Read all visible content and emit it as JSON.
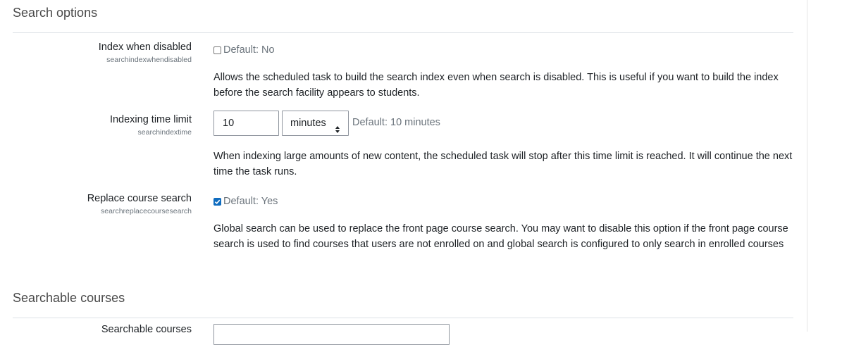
{
  "sections": {
    "search_options": "Search options",
    "searchable_courses": "Searchable courses"
  },
  "settings": {
    "index_disabled": {
      "label": "Index when disabled",
      "key": "searchindexwhendisabled",
      "checked": false,
      "default_text": "Default: No",
      "description": "Allows the scheduled task to build the search index even when search is disabled. This is useful if you want to build the index before the search facility appears to students."
    },
    "time_limit": {
      "label": "Indexing time limit",
      "key": "searchindextime",
      "value": "10",
      "unit": "minutes",
      "default_text": "Default: 10 minutes",
      "description": "When indexing large amounts of new content, the scheduled task will stop after this time limit is reached. It will continue the next time the task runs."
    },
    "replace_course_search": {
      "label": "Replace course search",
      "key": "searchreplacecoursesearch",
      "checked": true,
      "default_text": "Default: Yes",
      "description": "Global search can be used to replace the front page course search. You may want to disable this option if the front page course search is used to find courses that users are not enrolled on and global search is configured to only search in enrolled courses"
    },
    "searchable_courses": {
      "label": "Searchable courses"
    }
  },
  "colors": {
    "accent": "#0f6cbf",
    "muted": "#6a737b",
    "text": "#1d2125",
    "border": "#8f959e"
  }
}
